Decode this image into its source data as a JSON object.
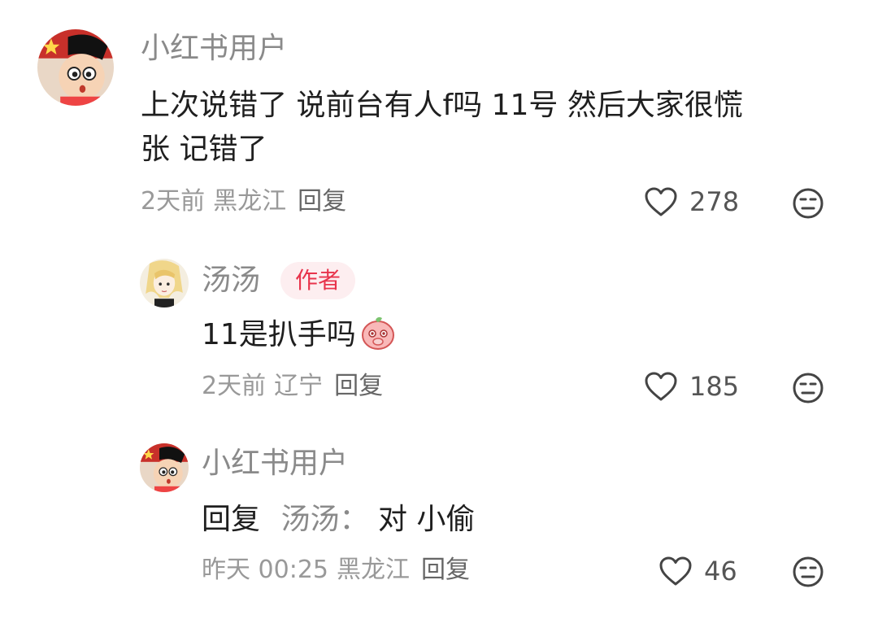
{
  "comments": [
    {
      "username": "小红书用户",
      "text_line1": "上次说错了 说前台有人f吗 11号 然后大家很慌",
      "text_line2": "张 记错了",
      "time": "2天前",
      "location": "黑龙江",
      "reply_label": "回复",
      "likes": "278"
    },
    {
      "username": "汤汤",
      "badge": "作者",
      "text": "11是扒手吗",
      "time": "2天前",
      "location": "辽宁",
      "reply_label": "回复",
      "likes": "185",
      "emoji": "peach-face-emoji"
    },
    {
      "username": "小红书用户",
      "reply_prefix": "回复",
      "reply_to": "汤汤：",
      "text": "对 小偷",
      "time": "昨天 00:25",
      "location": "黑龙江",
      "reply_label": "回复",
      "likes": "46"
    }
  ],
  "icons": {
    "like": "heart-outline-icon",
    "dislike": "meh-face-icon"
  },
  "colors": {
    "badge_text": "#e8344c",
    "badge_bg": "#fdeef0",
    "meta": "#999999"
  }
}
